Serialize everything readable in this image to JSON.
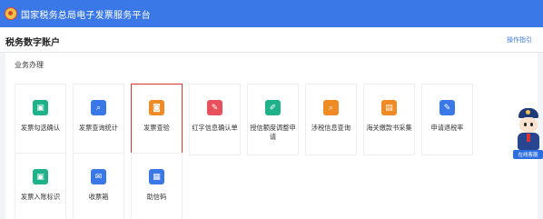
{
  "app": {
    "title": "国家税务总局电子发票服务平台"
  },
  "header": {
    "page_title": "税务数字账户",
    "help_label": "操作指引"
  },
  "section": {
    "title": "业务办理"
  },
  "tiles": [
    {
      "label": "发票勾选确认",
      "icon": "check-select-icon",
      "color": "#1fb28a",
      "glyph": "▣"
    },
    {
      "label": "发票查询统计",
      "icon": "search-stats-icon",
      "color": "#3b78e7",
      "glyph": "⌕"
    },
    {
      "label": "发票查验",
      "icon": "verify-icon",
      "color": "#f08a24",
      "glyph": "◙",
      "selected": true
    },
    {
      "label": "红字信息确认单",
      "icon": "red-letter-icon",
      "color": "#e8515c",
      "glyph": "✎"
    },
    {
      "label": "授信额度调整申请",
      "icon": "credit-adjust-icon",
      "color": "#1fb28a",
      "glyph": "✐"
    },
    {
      "label": "涉税信息查询",
      "icon": "tax-info-icon",
      "color": "#f08a24",
      "glyph": "⌕"
    },
    {
      "label": "海关缴款书采集",
      "icon": "customs-icon",
      "color": "#f08a24",
      "glyph": "▤"
    },
    {
      "label": "申请退税率",
      "icon": "refund-rate-icon",
      "color": "#3b78e7",
      "glyph": "✎"
    },
    {
      "label": "发票入账标识",
      "icon": "ledger-mark-icon",
      "color": "#1fb28a",
      "glyph": "▣"
    },
    {
      "label": "收票箱",
      "icon": "inbox-icon",
      "color": "#3b78e7",
      "glyph": "✉"
    },
    {
      "label": "助信码",
      "icon": "qr-code-icon",
      "color": "#3b78e7",
      "glyph": "▦"
    }
  ],
  "assistant": {
    "label": "在线客服"
  }
}
